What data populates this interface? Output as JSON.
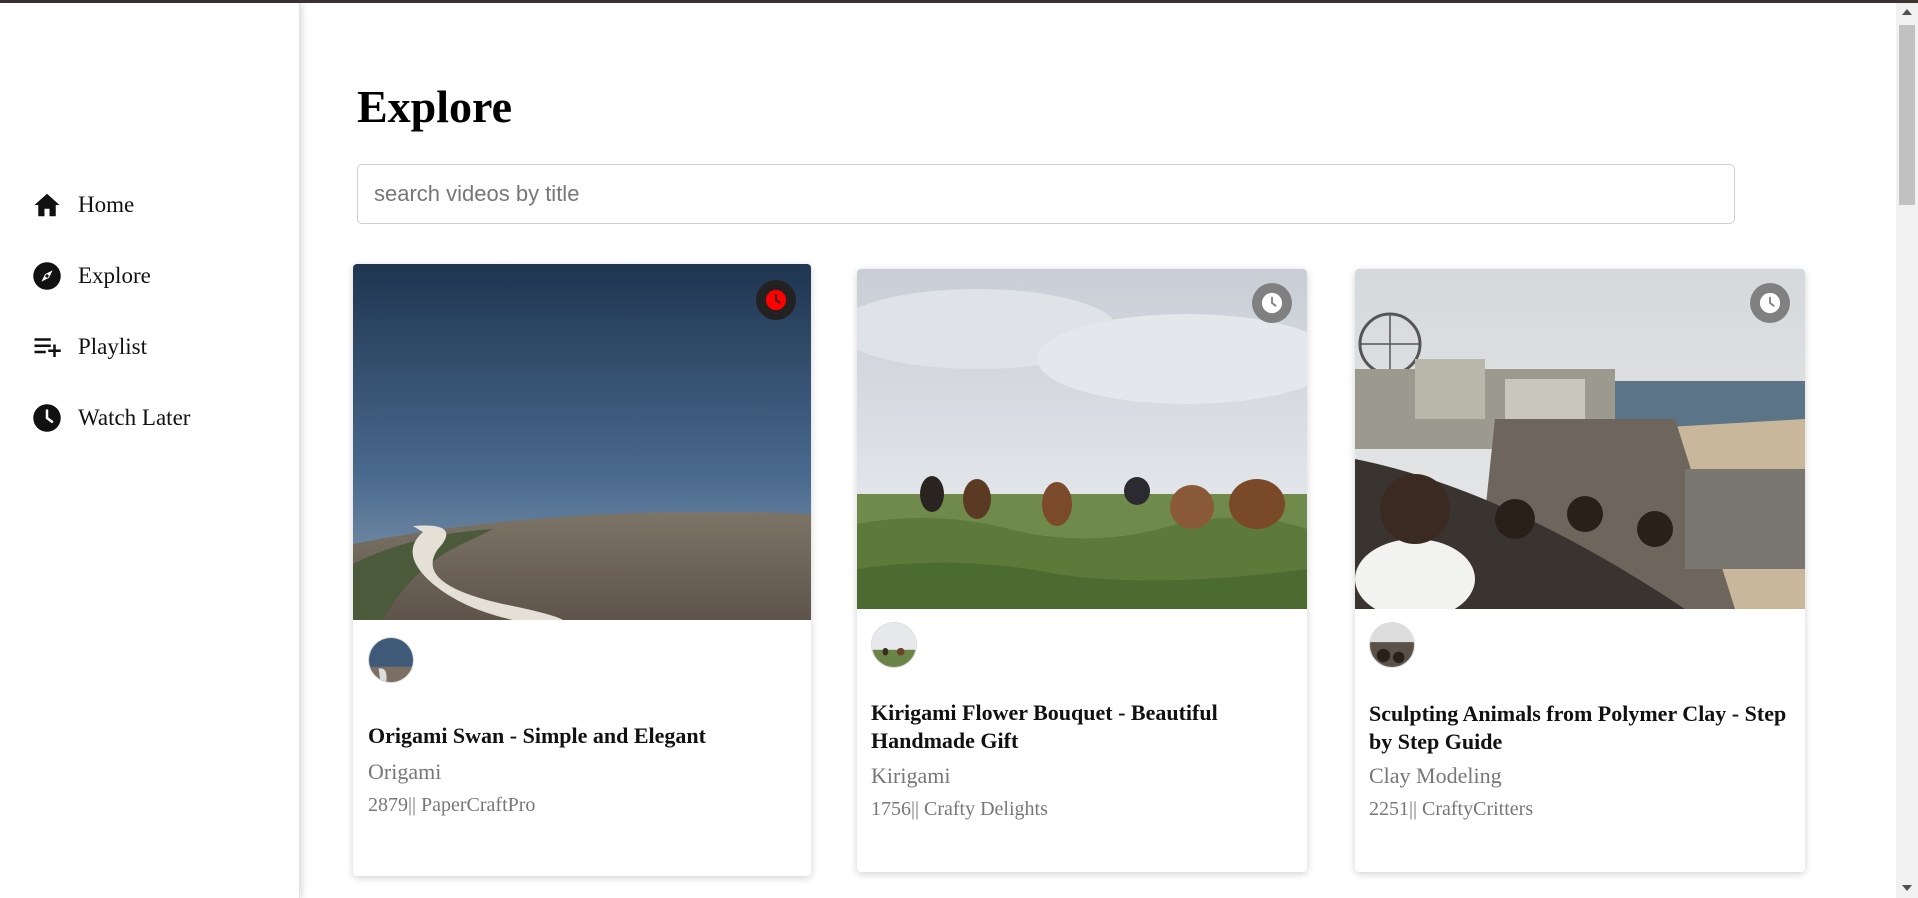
{
  "sidebar": {
    "items": [
      {
        "label": "Home",
        "icon": "home-icon"
      },
      {
        "label": "Explore",
        "icon": "compass-icon"
      },
      {
        "label": "Playlist",
        "icon": "playlist-add-icon"
      },
      {
        "label": "Watch Later",
        "icon": "clock-icon"
      }
    ]
  },
  "main": {
    "title": "Explore",
    "search": {
      "placeholder": "search videos by title",
      "value": ""
    },
    "videos": [
      {
        "title": "Origami Swan - Simple and Elegant",
        "category": "Origami",
        "views": "2879",
        "separator": "||",
        "creator": "PaperCraftPro",
        "watch_later_active": true
      },
      {
        "title": "Kirigami Flower Bouquet - Beautiful Handmade Gift",
        "category": "Kirigami",
        "views": "1756",
        "separator": "||",
        "creator": "Crafty Delights",
        "watch_later_active": false
      },
      {
        "title": "Sculpting Animals from Polymer Clay - Step by Step Guide",
        "category": "Clay Modeling",
        "views": "2251",
        "separator": "||",
        "creator": "CraftyCritters",
        "watch_later_active": false
      }
    ]
  },
  "colors": {
    "accent_active": "#ff0000",
    "muted_text": "#777777",
    "watch_later_inactive_bg": "#808080",
    "watch_later_active_bg": "#222222"
  }
}
